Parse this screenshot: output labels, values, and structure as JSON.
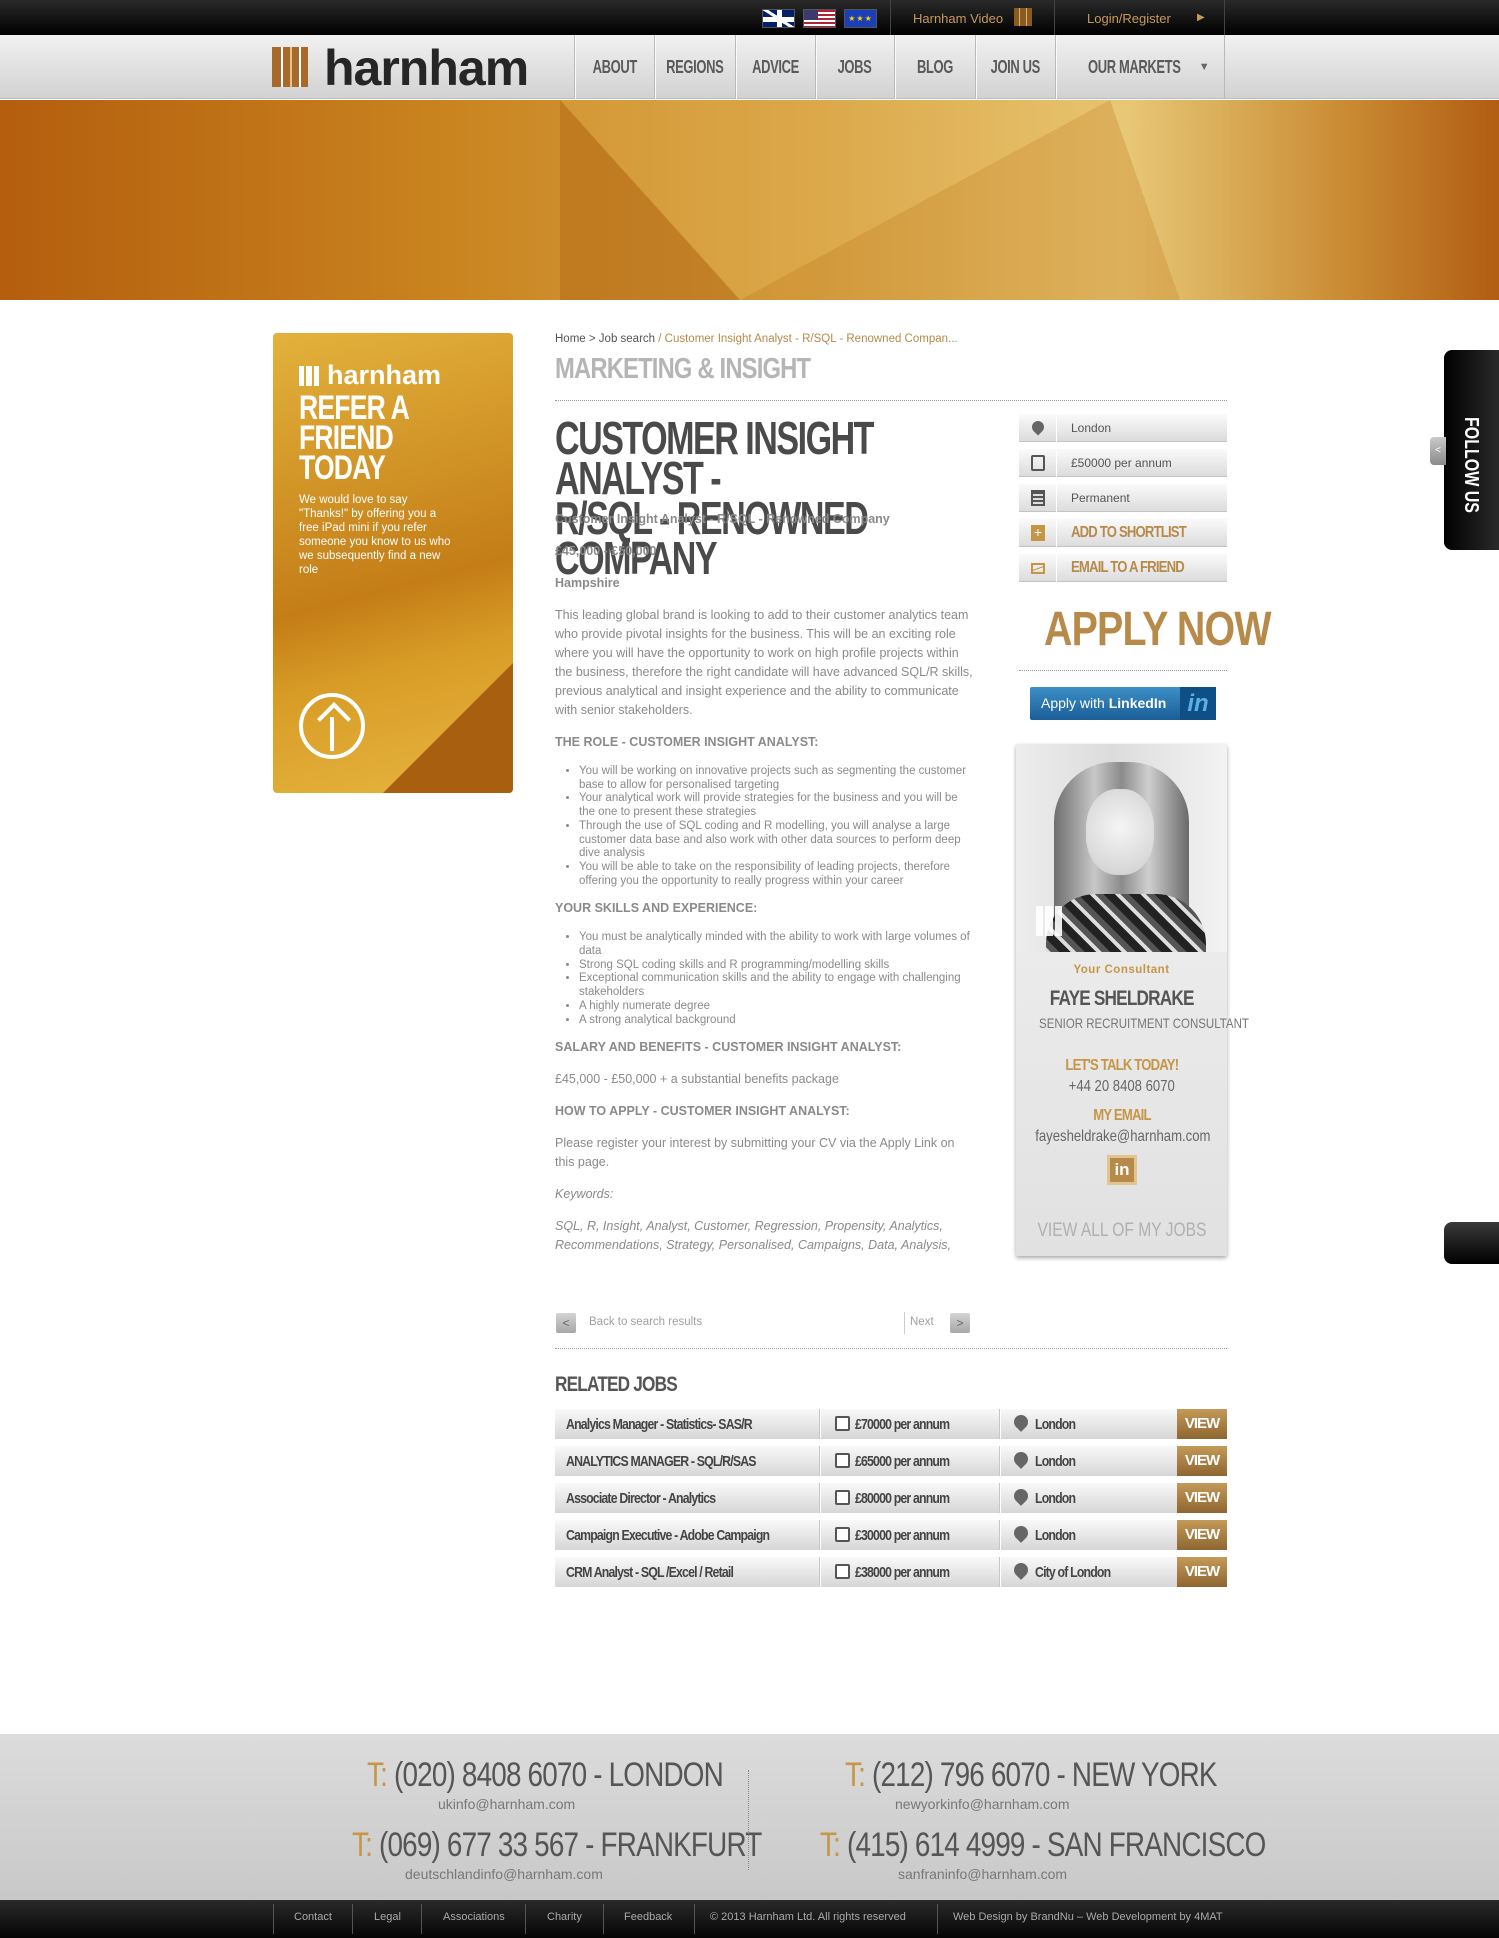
{
  "topbar": {
    "flags": [
      "uk-flag-icon",
      "us-flag-icon",
      "eu-flag-icon"
    ],
    "video_label": "Harnham Video",
    "login_label": "Login/Register"
  },
  "header": {
    "logo_text": "harnham",
    "nav": [
      "ABOUT",
      "REGIONS",
      "ADVICE",
      "JOBS",
      "BLOG",
      "JOIN US",
      "OUR MARKETS"
    ]
  },
  "refer": {
    "logo": "harnham",
    "title": [
      "REFER A",
      "FRIEND",
      "TODAY"
    ],
    "text": "We would love to say \"Thanks!\" by offering you a free iPad mini if you refer someone you know to us who we subsequently find a new role"
  },
  "breadcrumb": {
    "home": "Home",
    "sep1": " > ",
    "search": "Job search",
    "sep2": " / ",
    "current": "Customer Insight Analyst - R/SQL - Renowned Compan..."
  },
  "job": {
    "category": "MARKETING & INSIGHT",
    "title_line1": "CUSTOMER INSIGHT ANALYST -",
    "title_line2": "R/SQL - RENOWNED COMPANY",
    "subtitle": "Customer Insight Analyst - R/SQL - Renowned Company",
    "salary": "£45,000 - £50,000",
    "location": "Hampshire",
    "intro": "This leading global brand is looking to add to their customer analytics team who provide pivotal insights for the business. This will be an exciting role where you will have the opportunity to work on high profile projects within the business, therefore the right candidate will have advanced SQL/R skills, previous analytical and insight experience and the ability to communicate with senior stakeholders.",
    "role_heading": "THE ROLE - CUSTOMER INSIGHT ANALYST:",
    "role_items": [
      "You will be working on innovative projects such as segmenting the customer base to allow for personalised targeting",
      "Your analytical work will provide strategies for the business and you will be the one to present these strategies",
      "Through the use of SQL coding and R modelling, you will analyse a large customer data base and also work with other data sources to perform deep dive analysis",
      "You will be able to take on the responsibility of leading projects, therefore offering you the opportunity to really progress within your career"
    ],
    "skills_heading": "YOUR SKILLS AND EXPERIENCE:",
    "skills_items": [
      "You must be analytically minded with the ability to work with large volumes of data",
      "Strong SQL coding skills and R programming/modelling skills",
      "Exceptional communication skills and the ability to engage with challenging stakeholders",
      "A highly numerate degree",
      "A strong analytical background"
    ],
    "salary_heading": "SALARY AND BENEFITS - CUSTOMER INSIGHT ANALYST:",
    "salary_text": "£45,000 - £50,000 + a substantial benefits package",
    "apply_heading": "HOW TO APPLY - CUSTOMER INSIGHT ANALYST:",
    "apply_text": "Please register your interest by submitting your CV via the Apply Link on this page.",
    "keywords_label": "Keywords:",
    "keywords": "SQL, R, Insight, Analyst, Customer, Regression, Propensity, Analytics, Recommendations, Strategy, Personalised, Campaigns, Data, Analysis,"
  },
  "pager": {
    "back_arrow": "<",
    "back": "Back to search results",
    "next": "Next",
    "next_arrow": ">"
  },
  "info": {
    "location": "London",
    "salary": "£50000 per annum",
    "type": "Permanent",
    "shortlist": "ADD TO SHORTLIST",
    "email_friend": "EMAIL TO A FRIEND",
    "apply_now": "APPLY NOW",
    "apply_linkedin_pre": "Apply with ",
    "apply_linkedin_bold": "LinkedIn",
    "linkedin_logo": "in"
  },
  "consultant": {
    "label": "Your Consultant",
    "name": "FAYE SHELDRAKE",
    "role": "SENIOR RECRUITMENT CONSULTANT",
    "talk": "LET'S TALK TODAY!",
    "phone": "+44 20 8408 6070",
    "email_label": "MY EMAIL",
    "email": "fayesheldrake@harnham.com",
    "linkedin": "in",
    "view_all": "VIEW ALL OF MY JOBS"
  },
  "follow": {
    "label": "FOLLOW US",
    "tab": "<"
  },
  "related": {
    "title": "RELATED JOBS",
    "view_label": "VIEW",
    "rows": [
      {
        "title": "Analyics Manager - Statistics- SAS/R",
        "salary": "£70000 per annum",
        "location": "London"
      },
      {
        "title": "ANALYTICS MANAGER - SQL/R/SAS",
        "salary": "£65000 per annum",
        "location": "London"
      },
      {
        "title": "Associate Director - Analytics",
        "salary": "£80000 per annum",
        "location": "London"
      },
      {
        "title": "Campaign Executive - Adobe Campaign",
        "salary": "£30000 per annum",
        "location": "London"
      },
      {
        "title": "CRM Analyst - SQL /Excel / Retail",
        "salary": "£38000 per annum",
        "location": "City of London"
      }
    ]
  },
  "footer": {
    "offices": [
      {
        "t": "T:",
        "phone": "(020) 8408 6070 - LONDON",
        "email": "ukinfo@harnham.com"
      },
      {
        "t": "T:",
        "phone": "(212) 796 6070 - NEW YORK",
        "email": "newyorkinfo@harnham.com"
      },
      {
        "t": "T:",
        "phone": "(069) 677 33 567 - FRANKFURT",
        "email": "deutschlandinfo@harnham.com"
      },
      {
        "t": "T:",
        "phone": "(415) 614 4999 - SAN FRANCISCO",
        "email": "sanfraninfo@harnham.com"
      }
    ],
    "links": [
      "Contact",
      "Legal",
      "Associations",
      "Charity",
      "Feedback"
    ],
    "copyright": "© 2013 Harnham Ltd. All rights reserved",
    "credits": "Web Design by BrandNu  –  Web Development by 4MAT"
  },
  "colors": {
    "gold": "#b78a4a",
    "dark": "#2a2a2a",
    "linkedin": "#1a5e98"
  }
}
